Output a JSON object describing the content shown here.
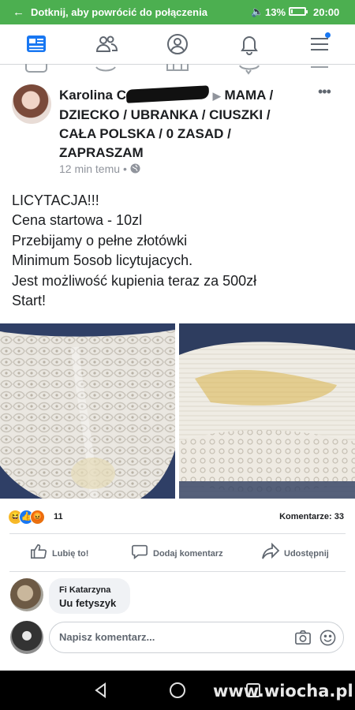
{
  "status_bar": {
    "back_arrow": "←",
    "message": "Dotknij, aby powrócić do połączenia",
    "volume_icon": "volume-icon",
    "battery_percent": "13%",
    "battery_level": 0.13,
    "time": "20:00",
    "background_color": "#4caf50"
  },
  "top_nav": {
    "items": [
      "home-feed-icon",
      "friends-icon",
      "profile-icon",
      "notifications-icon",
      "menu-icon"
    ],
    "accent_color": "#1877f2"
  },
  "post": {
    "author": "Karolina",
    "author_tail": "C",
    "arrow": "▶",
    "group": "MAMA / DZIECKO / UBRANKA / CIUSZKI / CAŁA POLSKA / 0 ZASAD / ZAPRASZAM",
    "time": "12 min temu",
    "separator": "•",
    "privacy_icon": "globe-icon",
    "more": "•••",
    "text_lines": [
      "LICYTACJA!!!",
      "Cena startowa - 10zl",
      "Przebijamy o pełne złotówki",
      "Minimum 5osob licytujacych.",
      "Jest możliwość kupienia teraz za 500zł",
      "Start!"
    ],
    "photos": [
      "lace-photo-1",
      "lace-photo-2"
    ],
    "reactions": {
      "icons": [
        "haha-reaction-icon",
        "like-reaction-icon",
        "angry-reaction-icon"
      ],
      "count": "11"
    },
    "comments_count": "Komentarze: 33",
    "actions": {
      "like": "Lubię to!",
      "comment": "Dodaj komentarz",
      "share": "Udostępnij"
    }
  },
  "comment": {
    "author": "Fi Katarzyna",
    "text": "Uu fetyszyk"
  },
  "compose": {
    "placeholder": "Napisz komentarz..."
  },
  "android_nav": [
    "back-icon",
    "home-icon",
    "recents-icon"
  ],
  "watermark": "www.wiocha.pl"
}
